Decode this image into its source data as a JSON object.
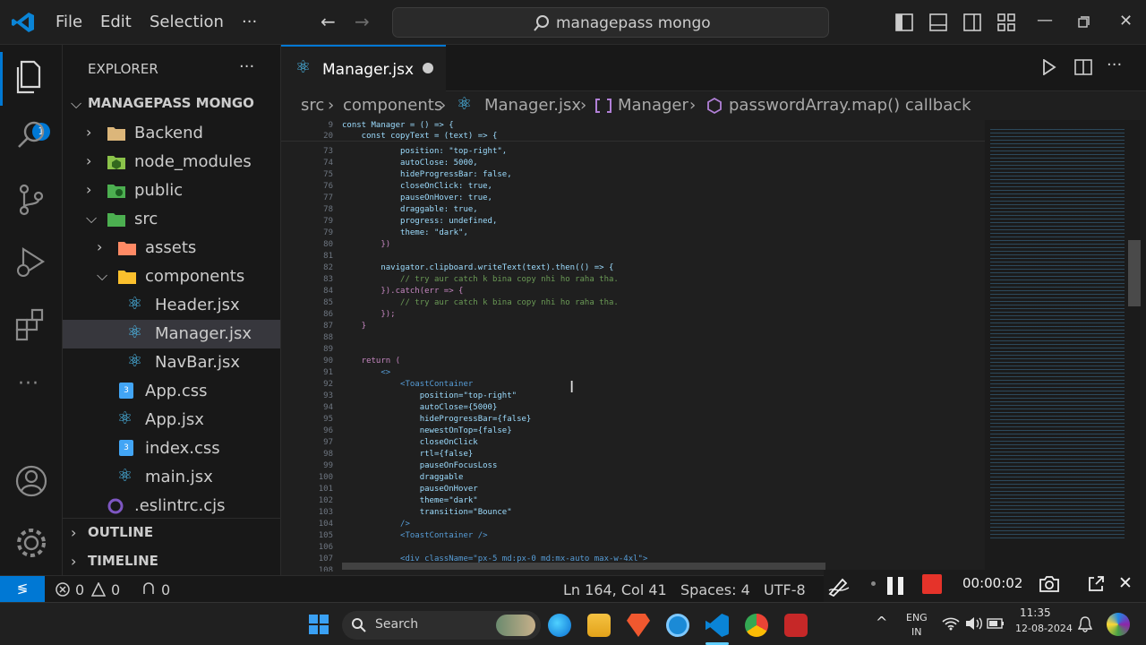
{
  "titlebar": {
    "menu": [
      "File",
      "Edit",
      "Selection",
      "···"
    ],
    "search_text": "managepass mongo"
  },
  "activity": {
    "explorer_badge": "1"
  },
  "sidebar": {
    "title": "EXPLORER",
    "project": "MANAGEPASS MONGO",
    "items": [
      {
        "label": "Backend",
        "type": "folder"
      },
      {
        "label": "node_modules",
        "type": "folder"
      },
      {
        "label": "public",
        "type": "folder"
      },
      {
        "label": "src",
        "type": "folder-open"
      },
      {
        "label": "assets",
        "type": "folder"
      },
      {
        "label": "components",
        "type": "folder-open"
      },
      {
        "label": "Header.jsx",
        "type": "react"
      },
      {
        "label": "Manager.jsx",
        "type": "react"
      },
      {
        "label": "NavBar.jsx",
        "type": "react"
      },
      {
        "label": "App.css",
        "type": "css"
      },
      {
        "label": "App.jsx",
        "type": "react"
      },
      {
        "label": "index.css",
        "type": "css"
      },
      {
        "label": "main.jsx",
        "type": "react"
      },
      {
        "label": ".eslintrc.cjs",
        "type": "eslint"
      }
    ],
    "outline": "OUTLINE",
    "timeline": "TIMELINE"
  },
  "editor": {
    "tab_label": "Manager.jsx",
    "breadcrumb": [
      "src",
      "components",
      "Manager.jsx",
      "Manager",
      "passwordArray.map() callback"
    ],
    "sticky_lines": [
      {
        "n": "9",
        "code": "const Manager = () => {"
      },
      {
        "n": "20",
        "code": "    const copyText = (text) => {"
      }
    ],
    "lines": [
      {
        "n": "73",
        "code": "            position: \"top-right\","
      },
      {
        "n": "74",
        "code": "            autoClose: 5000,"
      },
      {
        "n": "75",
        "code": "            hideProgressBar: false,"
      },
      {
        "n": "76",
        "code": "            closeOnClick: true,"
      },
      {
        "n": "77",
        "code": "            pauseOnHover: true,"
      },
      {
        "n": "78",
        "code": "            draggable: true,"
      },
      {
        "n": "79",
        "code": "            progress: undefined,"
      },
      {
        "n": "79",
        "code": "            theme: \"dark\","
      },
      {
        "n": "80",
        "code": "        })"
      },
      {
        "n": "81",
        "code": ""
      },
      {
        "n": "82",
        "code": "        navigator.clipboard.writeText(text).then(() => {"
      },
      {
        "n": "83",
        "code": "            // try aur catch k bina copy nhi ho raha tha."
      },
      {
        "n": "84",
        "code": "        }).catch(err => {"
      },
      {
        "n": "85",
        "code": "            // try aur catch k bina copy nhi ho raha tha."
      },
      {
        "n": "86",
        "code": "        });"
      },
      {
        "n": "87",
        "code": "    }"
      },
      {
        "n": "88",
        "code": ""
      },
      {
        "n": "89",
        "code": ""
      },
      {
        "n": "90",
        "code": "    return ("
      },
      {
        "n": "91",
        "code": "        <>"
      },
      {
        "n": "92",
        "code": "            <ToastContainer"
      },
      {
        "n": "93",
        "code": "                position=\"top-right\""
      },
      {
        "n": "94",
        "code": "                autoClose={5000}"
      },
      {
        "n": "95",
        "code": "                hideProgressBar={false}"
      },
      {
        "n": "96",
        "code": "                newestOnTop={false}"
      },
      {
        "n": "97",
        "code": "                closeOnClick"
      },
      {
        "n": "98",
        "code": "                rtl={false}"
      },
      {
        "n": "99",
        "code": "                pauseOnFocusLoss"
      },
      {
        "n": "100",
        "code": "                draggable"
      },
      {
        "n": "101",
        "code": "                pauseOnHover"
      },
      {
        "n": "102",
        "code": "                theme=\"dark\""
      },
      {
        "n": "103",
        "code": "                transition=\"Bounce\""
      },
      {
        "n": "104",
        "code": "            />"
      },
      {
        "n": "105",
        "code": "            <ToastContainer />"
      },
      {
        "n": "106",
        "code": ""
      },
      {
        "n": "107",
        "code": "            <div className=\"px-5 md:px-0 md:mx-auto max-w-4xl\">"
      },
      {
        "n": "108",
        "code": ""
      }
    ]
  },
  "statusbar": {
    "errors": "0",
    "warnings": "0",
    "ports": "0",
    "position": "Ln 164, Col 41",
    "spaces": "Spaces: 4",
    "encoding": "UTF-8"
  },
  "recorder": {
    "time": "00:00:02"
  },
  "taskbar": {
    "search": "Search",
    "lang_top": "ENG",
    "lang_bottom": "IN",
    "time": "11:35",
    "date": "12-08-2024"
  },
  "colors": {
    "accent": "#0078d4",
    "folder": "#dcb67a",
    "react": "#4fc3f7",
    "css": "#42a5f5",
    "record": "#e5332a"
  }
}
